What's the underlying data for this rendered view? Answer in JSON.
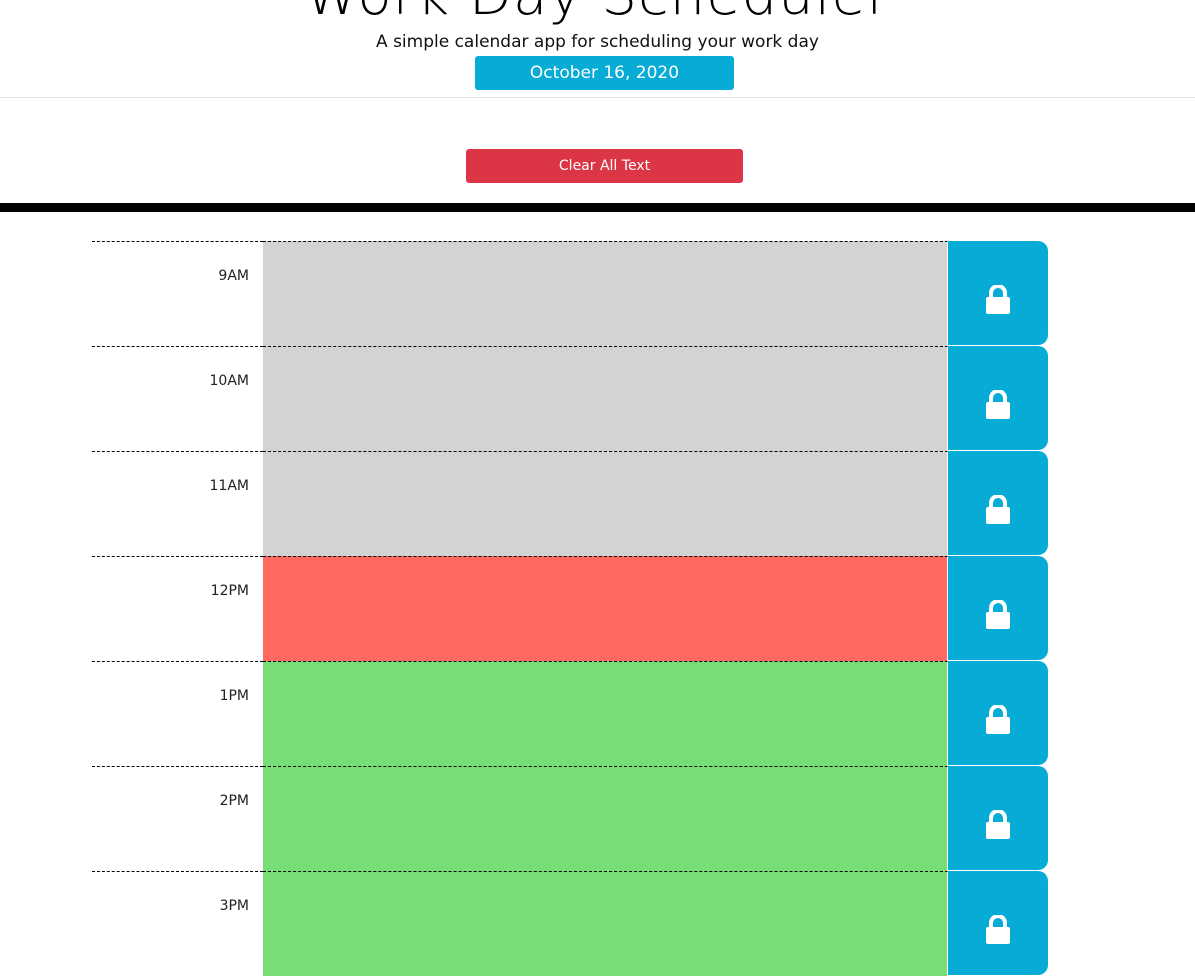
{
  "header": {
    "title": "Work Day Scheduler",
    "subtitle": "A simple calendar app for scheduling your work day",
    "date": "October 16, 2020"
  },
  "actions": {
    "clear_label": "Clear All Text"
  },
  "colors": {
    "past": "#d3d3d3",
    "present": "#ff6961",
    "future": "#77dd77",
    "save": "#06acd6",
    "clear": "#dc3545"
  },
  "rows": [
    {
      "hour": "9AM",
      "status": "past",
      "text": "",
      "save_icon": "lock-icon"
    },
    {
      "hour": "10AM",
      "status": "past",
      "text": "",
      "save_icon": "lock-icon"
    },
    {
      "hour": "11AM",
      "status": "past",
      "text": "",
      "save_icon": "lock-icon"
    },
    {
      "hour": "12PM",
      "status": "present",
      "text": "",
      "save_icon": "lock-icon"
    },
    {
      "hour": "1PM",
      "status": "future",
      "text": "",
      "save_icon": "lock-icon"
    },
    {
      "hour": "2PM",
      "status": "future",
      "text": "",
      "save_icon": "lock-icon"
    },
    {
      "hour": "3PM",
      "status": "future",
      "text": "",
      "save_icon": "lock-icon"
    }
  ]
}
